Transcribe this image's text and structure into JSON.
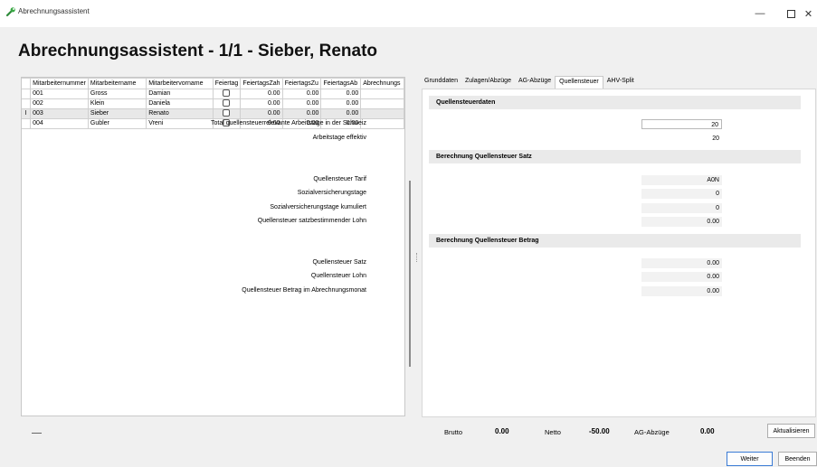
{
  "window": {
    "title": "Abrechnungsassistent",
    "min_glyph": "—",
    "close_glyph": "✕"
  },
  "page_title": "Abrechnungsassistent - 1/1 - Sieber, Renato",
  "grid": {
    "columns": [
      "Mitarbeiternummer",
      "Mitarbeitername",
      "Mitarbeitervorname",
      "Feiertag",
      "FeiertagsZah",
      "FeiertagsZu",
      "FeiertagsAb",
      "Abrechnungs"
    ],
    "rows": [
      {
        "indicator": "",
        "nr": "001",
        "name": "Gross",
        "vorname": "Damian",
        "zah": "0.00",
        "zu": "0.00",
        "ab": "0.00"
      },
      {
        "indicator": "",
        "nr": "002",
        "name": "Klein",
        "vorname": "Daniela",
        "zah": "0.00",
        "zu": "0.00",
        "ab": "0.00"
      },
      {
        "indicator": "I",
        "nr": "003",
        "name": "Sieber",
        "vorname": "Renato",
        "zah": "0.00",
        "zu": "0.00",
        "ab": "0.00"
      },
      {
        "indicator": "",
        "nr": "004",
        "name": "Gubler",
        "vorname": "Vreni",
        "zah": "0.00",
        "zu": "0.00",
        "ab": "0.00"
      }
    ]
  },
  "tabs": [
    "Grunddaten",
    "Zulagen/Abzüge",
    "AG-Abzüge",
    "Quellensteuer",
    "AHV-Split"
  ],
  "quellensteuerdaten": {
    "header": "Quellensteuerdaten",
    "total_label": "Total quellensteuerrelevante Arbeitstage in der Schweiz",
    "total_value": "20",
    "effektiv_label": "Arbeitstage effektiv",
    "effektiv_value": "20"
  },
  "satz": {
    "header": "Berechnung Quellensteuer Satz",
    "tarif_label": "Quellensteuer Tarif",
    "tarif_value": "A0N",
    "sv_label": "Sozialversicherungstage",
    "sv_value": "0",
    "svk_label": "Sozialversicherungstage kumuliert",
    "svk_value": "0",
    "lohn_label": "Quellensteuer satzbestimmender Lohn",
    "lohn_value": "0.00"
  },
  "betrag": {
    "header": "Berechnung Quellensteuer Betrag",
    "satz_label": "Quellensteuer Satz",
    "satz_value": "0.00",
    "lohn_label": "Quellensteuer Lohn",
    "lohn_value": "0.00",
    "monat_label": "Quellensteuer Betrag im Abrechnungsmonat",
    "monat_value": "0.00"
  },
  "footer": {
    "brutto_label": "Brutto",
    "brutto_value": "0.00",
    "netto_label": "Netto",
    "netto_value": "-50.00",
    "ag_label": "AG-Abzüge",
    "ag_value": "0.00",
    "aktualisieren": "Aktualisieren",
    "weiter": "Weiter",
    "beenden": "Beenden"
  }
}
